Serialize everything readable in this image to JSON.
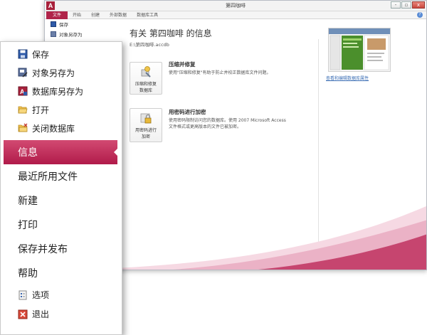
{
  "window": {
    "title": "第四咖啡",
    "app_icon_letter": "A",
    "controls": {
      "minimize": "-",
      "restore": "▫",
      "close": "x"
    }
  },
  "ribbon": {
    "tabs": [
      "文件",
      "开始",
      "创建",
      "外部数据",
      "数据库工具"
    ],
    "help": "?"
  },
  "backstage_small": {
    "items": [
      {
        "label": "保存",
        "icon": "save-icon"
      },
      {
        "label": "对象另存为",
        "icon": "save-as-object-icon"
      }
    ]
  },
  "info": {
    "title": "有关 第四咖啡 的信息",
    "path": "E:\\第四咖啡.accdb",
    "compact": {
      "button_line1": "压缩和修复",
      "button_line2": "数据库",
      "title": "压缩并修复",
      "description": "使用\"压缩和修复\"有助于防止并校正数据库文件问题。"
    },
    "encrypt": {
      "button_line1": "用密码进行",
      "button_line2": "加密",
      "title": "用密码进行加密",
      "description_line1": "使用密码限制访问您的数据库。使用 2007 Microsoft Access",
      "description_line2": "文件格式或更高版本的文件已被加密。"
    },
    "properties_link": "查看和编辑数据库属性"
  },
  "file_menu": {
    "top_items": [
      {
        "label": "保存",
        "icon": "save-icon"
      },
      {
        "label": "对象另存为",
        "icon": "save-object-as-icon"
      },
      {
        "label": "数据库另存为",
        "icon": "save-database-as-icon"
      },
      {
        "label": "打开",
        "icon": "open-folder-icon"
      },
      {
        "label": "关闭数据库",
        "icon": "close-database-icon"
      }
    ],
    "selected": "信息",
    "big_items": [
      "最近所用文件",
      "新建",
      "打印",
      "保存并发布",
      "帮助"
    ],
    "bottom_items": [
      {
        "label": "选项",
        "icon": "options-icon"
      },
      {
        "label": "退出",
        "icon": "exit-icon"
      }
    ]
  },
  "colors": {
    "accent": "#b11b4a",
    "accent_light": "#d24a72",
    "link": "#3d6fb5"
  }
}
